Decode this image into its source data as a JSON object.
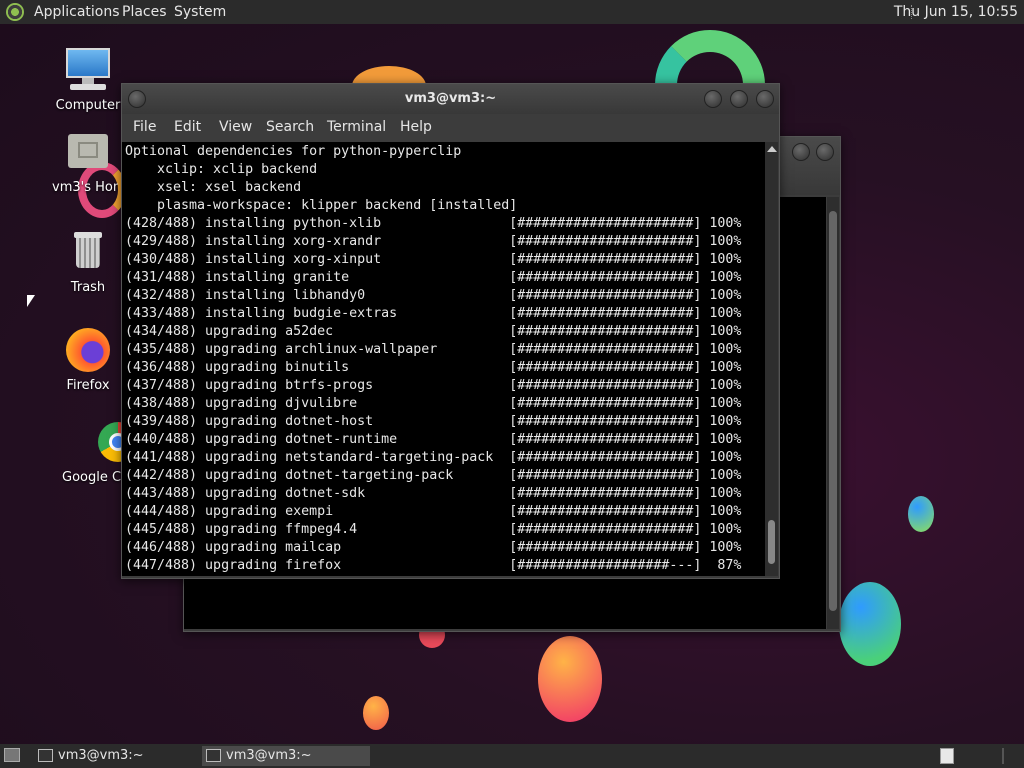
{
  "top_panel": {
    "menus": [
      "Applications",
      "Places",
      "System"
    ],
    "clock": "Thu Jun 15, 10:55"
  },
  "desktop_icons": [
    {
      "label": "Computer",
      "icon": "computer-icon"
    },
    {
      "label": "vm3's Home",
      "icon": "home-folder-icon"
    },
    {
      "label": "Trash",
      "icon": "trash-icon"
    },
    {
      "label": "Firefox",
      "icon": "firefox-icon"
    },
    {
      "label": "Google Chrome",
      "icon": "chrome-icon"
    }
  ],
  "terminal_window": {
    "title": "vm3@vm3:~",
    "menu": [
      "File",
      "Edit",
      "View",
      "Search",
      "Terminal",
      "Help"
    ],
    "lines": [
      "Optional dependencies for python-pyperclip",
      "    xclip: xclip backend",
      "    xsel: xsel backend",
      "    plasma-workspace: klipper backend [installed]",
      "(428/488) installing python-xlib                [######################] 100%",
      "(429/488) installing xorg-xrandr                [######################] 100%",
      "(430/488) installing xorg-xinput                [######################] 100%",
      "(431/488) installing granite                    [######################] 100%",
      "(432/488) installing libhandy0                  [######################] 100%",
      "(433/488) installing budgie-extras              [######################] 100%",
      "(434/488) upgrading a52dec                      [######################] 100%",
      "(435/488) upgrading archlinux-wallpaper         [######################] 100%",
      "(436/488) upgrading binutils                    [######################] 100%",
      "(437/488) upgrading btrfs-progs                 [######################] 100%",
      "(438/488) upgrading djvulibre                   [######################] 100%",
      "(439/488) upgrading dotnet-host                 [######################] 100%",
      "(440/488) upgrading dotnet-runtime              [######################] 100%",
      "(441/488) upgrading netstandard-targeting-pack  [######################] 100%",
      "(442/488) upgrading dotnet-targeting-pack       [######################] 100%",
      "(443/488) upgrading dotnet-sdk                  [######################] 100%",
      "(444/488) upgrading exempi                      [######################] 100%",
      "(445/488) upgrading ffmpeg4.4                   [######################] 100%",
      "(446/488) upgrading mailcap                     [######################] 100%",
      "(447/488) upgrading firefox                     [###################---]  87%"
    ]
  },
  "taskbar": {
    "tasks": [
      {
        "label": "vm3@vm3:~",
        "active": false
      },
      {
        "label": "vm3@vm3:~",
        "active": true
      }
    ]
  },
  "colors": {
    "panel": "#2b2b2b",
    "terminal_bg": "#000000",
    "terminal_fg": "#e8e8e8"
  }
}
